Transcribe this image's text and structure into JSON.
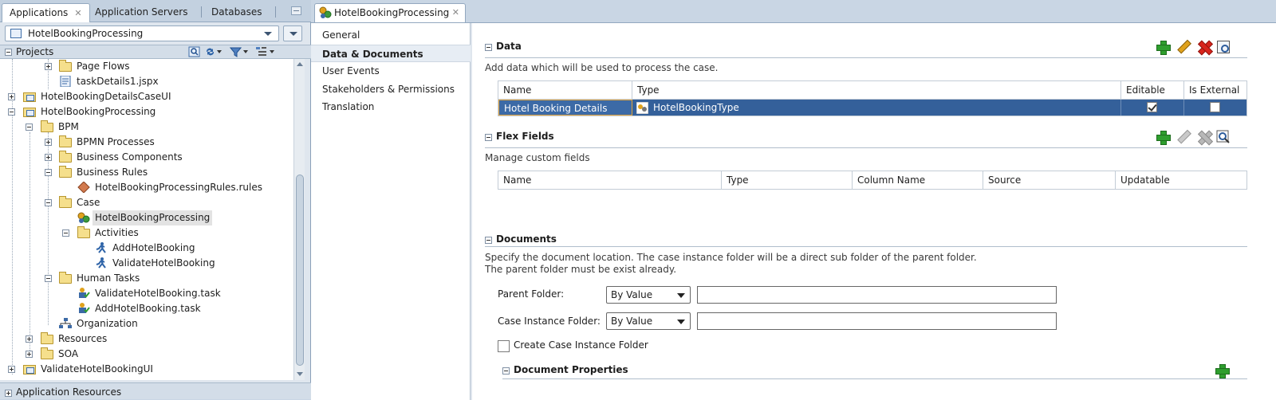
{
  "left_tabs": [
    {
      "label": "Applications",
      "active": true,
      "closable": true
    },
    {
      "label": "Application Servers"
    },
    {
      "label": "Databases"
    }
  ],
  "app_selector": {
    "value": "HotelBookingProcessing"
  },
  "projects_label": "Projects",
  "tree": [
    {
      "label": "Page Flows",
      "depth": 2,
      "toggle": "plus",
      "icon": "folder"
    },
    {
      "label": "taskDetails1.jspx",
      "depth": 2,
      "toggle": null,
      "icon": "jspx-file"
    },
    {
      "label": "HotelBookingDetailsCaseUI",
      "depth": 0,
      "toggle": "plus",
      "icon": "project"
    },
    {
      "label": "HotelBookingProcessing",
      "depth": 0,
      "toggle": "minus",
      "icon": "project"
    },
    {
      "label": "BPM",
      "depth": 1,
      "toggle": "minus",
      "icon": "folder"
    },
    {
      "label": "BPMN Processes",
      "depth": 2,
      "toggle": "plus",
      "icon": "bpmn-folder"
    },
    {
      "label": "Business Components",
      "depth": 2,
      "toggle": "plus",
      "icon": "components-folder"
    },
    {
      "label": "Business Rules",
      "depth": 2,
      "toggle": "minus",
      "icon": "rules-folder"
    },
    {
      "label": "HotelBookingProcessingRules.rules",
      "depth": 3,
      "toggle": null,
      "icon": "rules-file"
    },
    {
      "label": "Case",
      "depth": 2,
      "toggle": "minus",
      "icon": "case-folder"
    },
    {
      "label": "HotelBookingProcessing",
      "depth": 3,
      "toggle": null,
      "icon": "case-file",
      "selected": true
    },
    {
      "label": "Activities",
      "depth": 3,
      "toggle": "minus",
      "icon": "folder"
    },
    {
      "label": "AddHotelBooking",
      "depth": 4,
      "toggle": null,
      "icon": "activity"
    },
    {
      "label": "ValidateHotelBooking",
      "depth": 4,
      "toggle": null,
      "icon": "activity"
    },
    {
      "label": "Human Tasks",
      "depth": 2,
      "toggle": "minus",
      "icon": "tasks-folder"
    },
    {
      "label": "ValidateHotelBooking.task",
      "depth": 3,
      "toggle": null,
      "icon": "task-file"
    },
    {
      "label": "AddHotelBooking.task",
      "depth": 3,
      "toggle": null,
      "icon": "task-file"
    },
    {
      "label": "Organization",
      "depth": 2,
      "toggle": null,
      "icon": "organization"
    },
    {
      "label": "Resources",
      "depth": 1,
      "toggle": "plus",
      "icon": "folder"
    },
    {
      "label": "SOA",
      "depth": 1,
      "toggle": "plus",
      "icon": "folder"
    },
    {
      "label": "ValidateHotelBookingUI",
      "depth": 0,
      "toggle": "plus",
      "icon": "project"
    }
  ],
  "app_resources_label": "Application Resources",
  "editor_tab": {
    "label": "HotelBookingProcessing"
  },
  "nav": [
    {
      "label": "General"
    },
    {
      "label": "Data & Documents",
      "active": true
    },
    {
      "label": "User Events"
    },
    {
      "label": "Stakeholders & Permissions"
    },
    {
      "label": "Translation"
    }
  ],
  "data_section": {
    "title": "Data",
    "description": "Add data which will be used to process the case.",
    "columns": [
      "Name",
      "Type",
      "Editable",
      "Is External"
    ],
    "rows": [
      {
        "name": "Hotel Booking Details",
        "type": "HotelBookingType",
        "editable": true,
        "is_external": false
      }
    ]
  },
  "flex_section": {
    "title": "Flex Fields",
    "description": "Manage custom fields",
    "columns": [
      "Name",
      "Type",
      "Column Name",
      "Source",
      "Updatable"
    ]
  },
  "documents_section": {
    "title": "Documents",
    "description_line1": "Specify the document location. The case instance folder will be a direct sub folder of the parent folder.",
    "description_line2": "The parent folder must be exist already.",
    "parent_folder_label": "Parent Folder:",
    "parent_folder_mode": "By Value",
    "parent_folder_value": "",
    "case_instance_label": "Case Instance Folder:",
    "case_instance_mode": "By Value",
    "case_instance_value": "",
    "create_checkbox_label": "Create Case Instance Folder",
    "create_checked": false,
    "doc_props_title": "Document Properties"
  },
  "colors": {
    "selection_row": "#34609a",
    "add_green": "#2e9e2e",
    "delete_red": "#d8241c"
  }
}
